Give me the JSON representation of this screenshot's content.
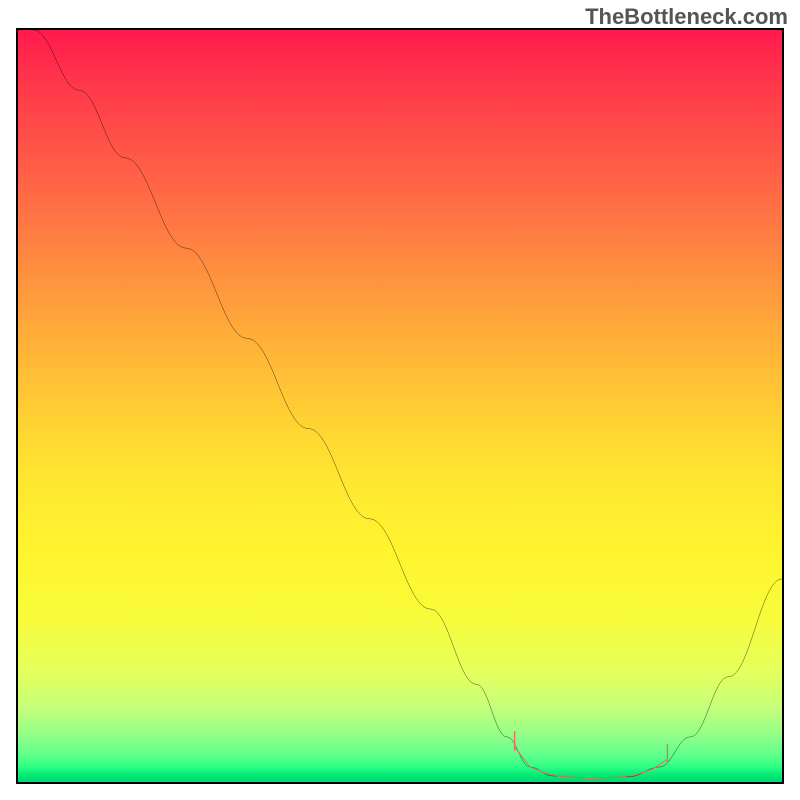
{
  "watermark": "TheBottleneck.com",
  "chart_data": {
    "type": "line",
    "title": "",
    "xlabel": "",
    "ylabel": "",
    "xlim": [
      0,
      100
    ],
    "ylim": [
      0,
      100
    ],
    "gradient_stops": [
      {
        "pos": 0,
        "color": "#ff1a4d"
      },
      {
        "pos": 22,
        "color": "#ff6a45"
      },
      {
        "pos": 42,
        "color": "#ffb238"
      },
      {
        "pos": 60,
        "color": "#ffe730"
      },
      {
        "pos": 78,
        "color": "#f8fb3a"
      },
      {
        "pos": 90,
        "color": "#c6ff7a"
      },
      {
        "pos": 96.5,
        "color": "#5cff8c"
      },
      {
        "pos": 100,
        "color": "#00d86f"
      }
    ],
    "series": [
      {
        "name": "bottleneck-curve",
        "color": "#000000",
        "points": [
          {
            "x": 2,
            "y": 100
          },
          {
            "x": 8,
            "y": 92
          },
          {
            "x": 14,
            "y": 83
          },
          {
            "x": 22,
            "y": 71
          },
          {
            "x": 30,
            "y": 59
          },
          {
            "x": 38,
            "y": 47
          },
          {
            "x": 46,
            "y": 35
          },
          {
            "x": 54,
            "y": 23
          },
          {
            "x": 60,
            "y": 13
          },
          {
            "x": 64,
            "y": 6
          },
          {
            "x": 67,
            "y": 2
          },
          {
            "x": 70,
            "y": 0.8
          },
          {
            "x": 75,
            "y": 0.5
          },
          {
            "x": 80,
            "y": 0.7
          },
          {
            "x": 84,
            "y": 2
          },
          {
            "x": 88,
            "y": 6
          },
          {
            "x": 93,
            "y": 14
          },
          {
            "x": 100,
            "y": 27
          }
        ]
      },
      {
        "name": "optimal-band-markers",
        "color": "#f06a6a",
        "marker_xs": [
          65,
          67,
          69,
          71,
          73,
          75,
          77,
          79,
          81,
          83,
          85
        ],
        "marker_y_at": "curve"
      }
    ],
    "annotations": []
  }
}
